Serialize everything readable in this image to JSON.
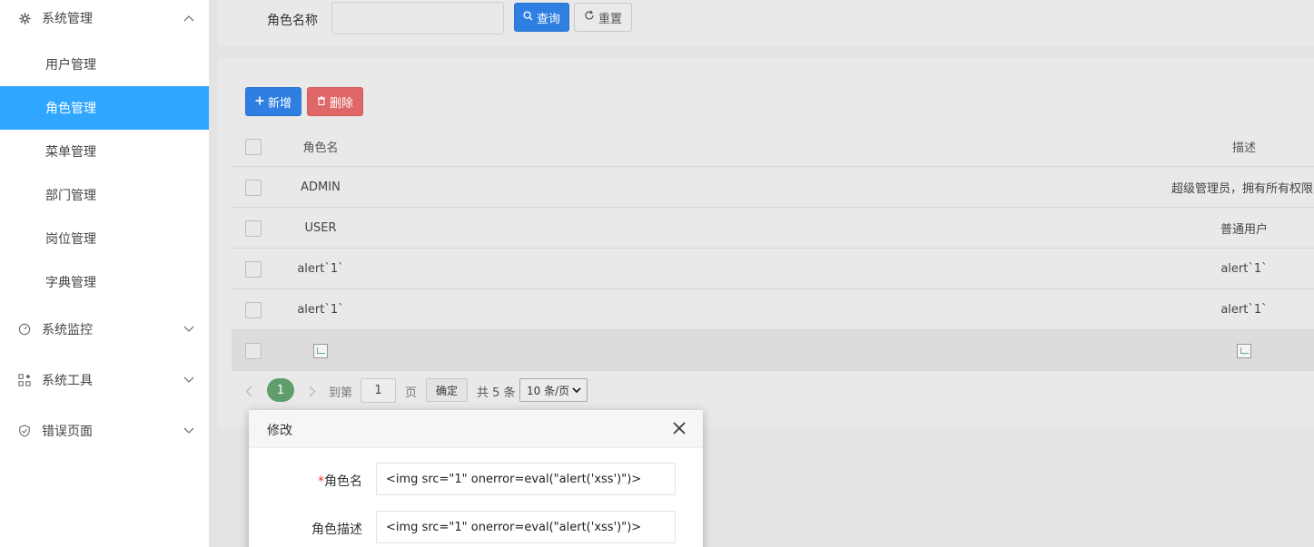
{
  "sidebar": {
    "groups": [
      {
        "label": "系统管理",
        "icon": "gear-icon",
        "expanded": true
      },
      {
        "label": "系统监控",
        "icon": "dashboard-icon",
        "expanded": false
      },
      {
        "label": "系统工具",
        "icon": "apps-icon",
        "expanded": false
      },
      {
        "label": "错误页面",
        "icon": "shield-icon",
        "expanded": false
      }
    ],
    "items": [
      {
        "label": "用户管理"
      },
      {
        "label": "角色管理",
        "active": true
      },
      {
        "label": "菜单管理"
      },
      {
        "label": "部门管理"
      },
      {
        "label": "岗位管理"
      },
      {
        "label": "字典管理"
      }
    ]
  },
  "search": {
    "label": "角色名称",
    "value": "",
    "query_label": "查询",
    "reset_label": "重置"
  },
  "toolbar": {
    "add_label": "新增",
    "delete_label": "删除"
  },
  "table": {
    "headers": {
      "name": "角色名",
      "desc": "描述"
    },
    "rows": [
      {
        "name": "ADMIN",
        "desc": "超级管理员，拥有所有权限"
      },
      {
        "name": "USER",
        "desc": "普通用户"
      },
      {
        "name": "alert`1`",
        "desc": "alert`1`"
      },
      {
        "name": "alert`1`",
        "desc": "alert`1`"
      }
    ]
  },
  "pagination": {
    "current": "1",
    "goto_label": "到第",
    "goto_value": "1",
    "page_unit": "页",
    "confirm_label": "确定",
    "total": "共 5 条",
    "page_size": "10 条/页"
  },
  "modal": {
    "title": "修改",
    "required_mark": "*",
    "name_label": "角色名",
    "name_value": "<img src=\"1\" onerror=eval(\"alert('xss')\")>",
    "desc_label": "角色描述",
    "desc_value": "<img src=\"1\" onerror=eval(\"alert('xss')\")>"
  },
  "colors": {
    "active_menu": "#2fa6ff",
    "primary_button": "#2f7fe2",
    "danger_button": "#e06767",
    "current_page": "#5f9e6a"
  }
}
